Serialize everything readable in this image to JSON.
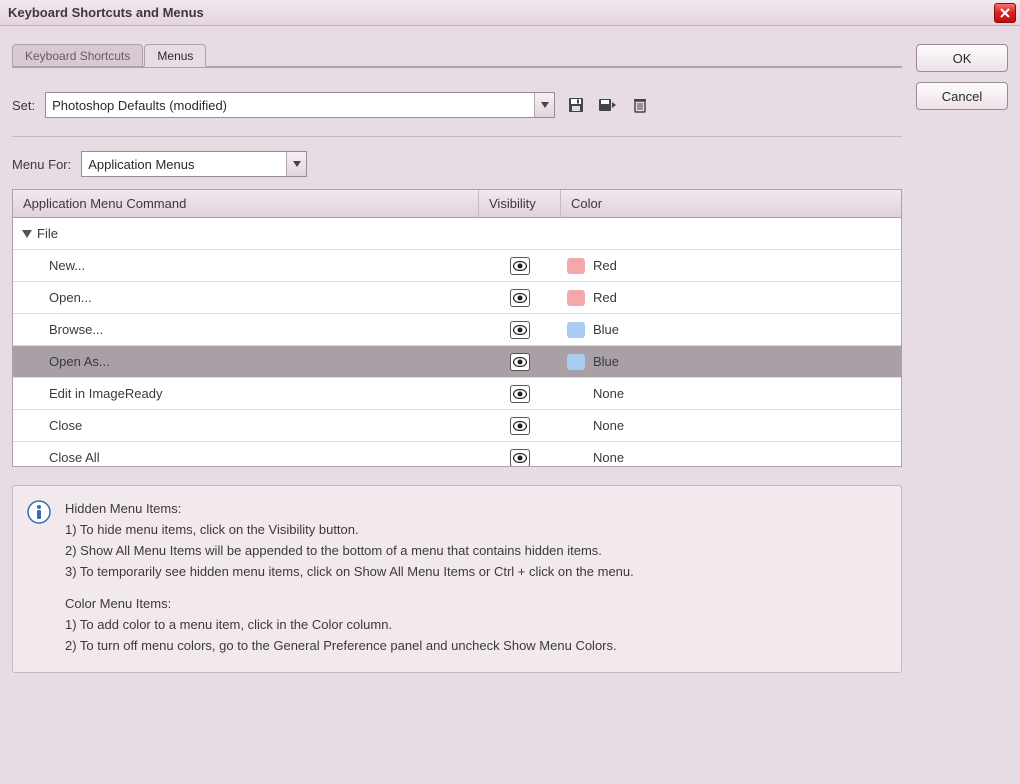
{
  "title": "Keyboard Shortcuts and Menus",
  "buttons": {
    "ok": "OK",
    "cancel": "Cancel"
  },
  "tabs": {
    "shortcuts": "Keyboard Shortcuts",
    "menus": "Menus"
  },
  "set": {
    "label": "Set:",
    "value": "Photoshop Defaults (modified)"
  },
  "menuFor": {
    "label": "Menu For:",
    "value": "Application Menus"
  },
  "columns": {
    "cmd": "Application Menu Command",
    "vis": "Visibility",
    "color": "Color"
  },
  "group": {
    "file": "File"
  },
  "rows": [
    {
      "label": "New...",
      "color": "Red",
      "swatch": "red"
    },
    {
      "label": "Open...",
      "color": "Red",
      "swatch": "red"
    },
    {
      "label": "Browse...",
      "color": "Blue",
      "swatch": "blue"
    },
    {
      "label": "Open As...",
      "color": "Blue",
      "swatch": "blue",
      "selected": true
    },
    {
      "label": "Edit in ImageReady",
      "color": "None",
      "swatch": "none"
    },
    {
      "label": "Close",
      "color": "None",
      "swatch": "none"
    },
    {
      "label": "Close All",
      "color": "None",
      "swatch": "none"
    }
  ],
  "info": {
    "h1": "Hidden Menu Items:",
    "l1": "1) To hide menu items, click on the Visibility button.",
    "l2": "2) Show All Menu Items will be appended to the bottom of a menu that contains hidden items.",
    "l3": "3) To temporarily see hidden menu items, click on Show All Menu Items or Ctrl + click on the menu.",
    "h2": "Color Menu Items:",
    "l4": "1) To add color to a menu item, click in the Color column.",
    "l5": "2) To turn off menu colors, go to the General Preference panel and uncheck Show Menu Colors."
  }
}
